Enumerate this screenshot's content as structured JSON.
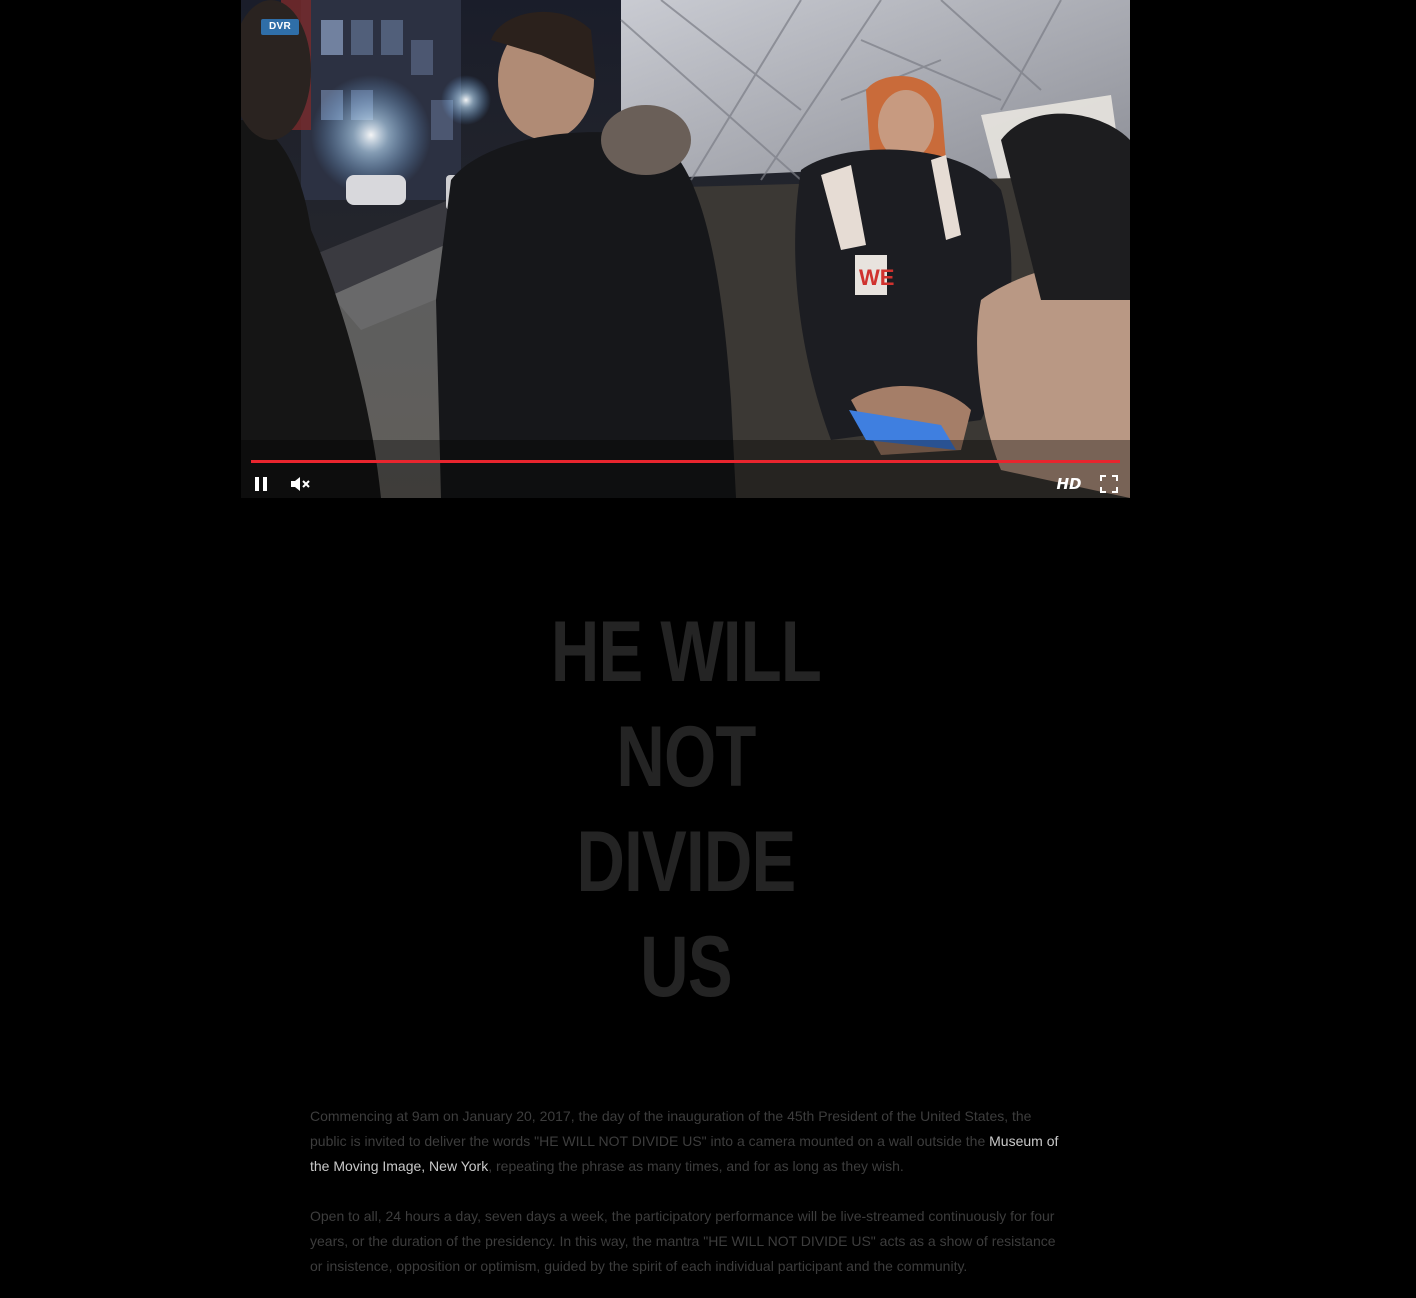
{
  "player": {
    "dvr_badge": "DVR",
    "hd_label": "HD",
    "progress": 1.0,
    "progress_color": "#e8252e",
    "icons": [
      "pause-icon",
      "mute-icon",
      "fullscreen-icon"
    ]
  },
  "title": {
    "lines": [
      "HE WILL",
      "NOT",
      "DIVIDE",
      "US"
    ]
  },
  "description": {
    "p1_before": "Commencing at 9am on January 20, 2017, the day of the inauguration of the 45th President of the United States, the public is invited to deliver the words \"HE WILL NOT DIVIDE US\" into a camera mounted on a wall outside the ",
    "p1_link": "Museum of the Moving Image, New York",
    "p1_after": ", repeating the phrase as many times, and for as long as they wish.",
    "p2": "Open to all, 24 hours a day, seven days a week, the participatory performance will be live-streamed continuously for four years, or the duration of the presidency. In this way, the mantra \"HE WILL NOT DIVIDE US\" acts as a show of resistance or insistence, opposition or optimism, guided by the spirit of each individual participant and the community."
  }
}
